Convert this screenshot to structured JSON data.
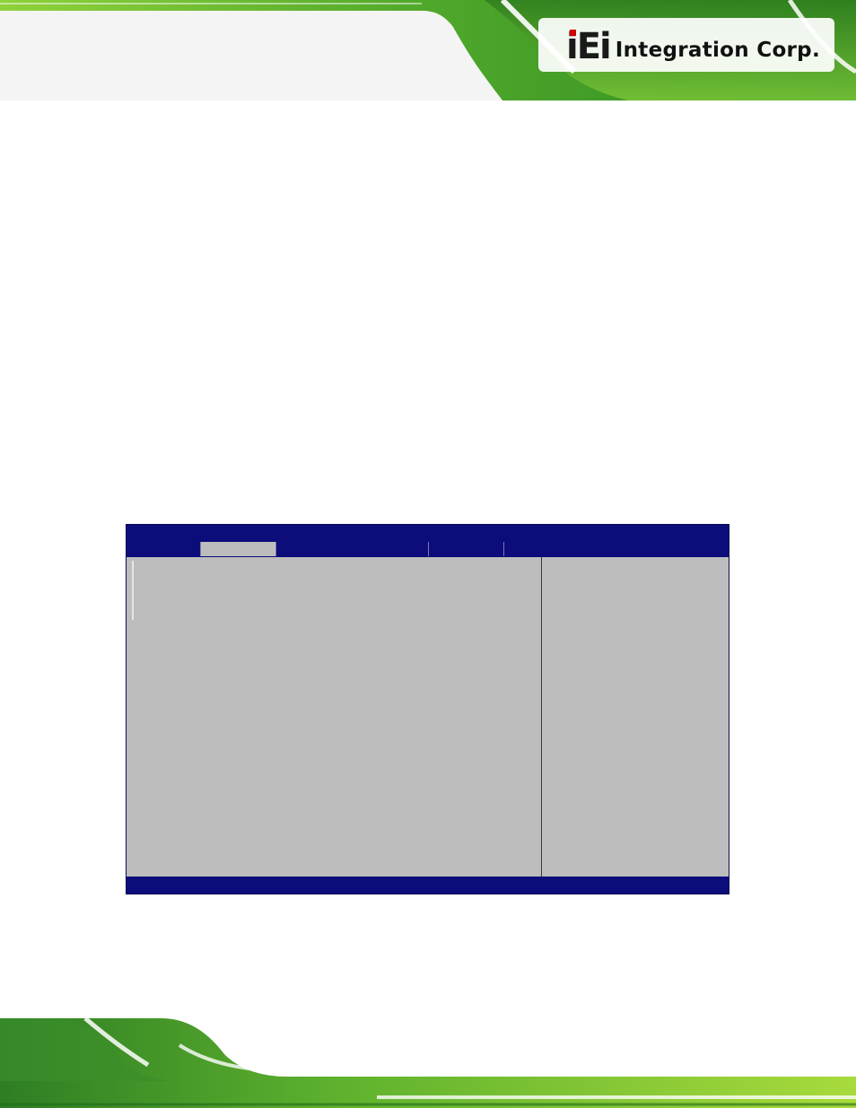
{
  "header": {
    "logo_mark": "iEi",
    "logo_text": "Integration Corp."
  },
  "bios": {
    "title": "",
    "tabs": [
      {
        "label": "",
        "active": false
      },
      {
        "label": "",
        "active": true
      },
      {
        "label": "",
        "active": false
      },
      {
        "label": "",
        "active": false
      },
      {
        "label": "",
        "active": false
      },
      {
        "label": "",
        "active": false
      }
    ],
    "status": ""
  },
  "colors": {
    "bios_blue": "#0c0c7a",
    "bios_gray": "#bdbdbd",
    "brand_green": "#6cbf2a"
  }
}
